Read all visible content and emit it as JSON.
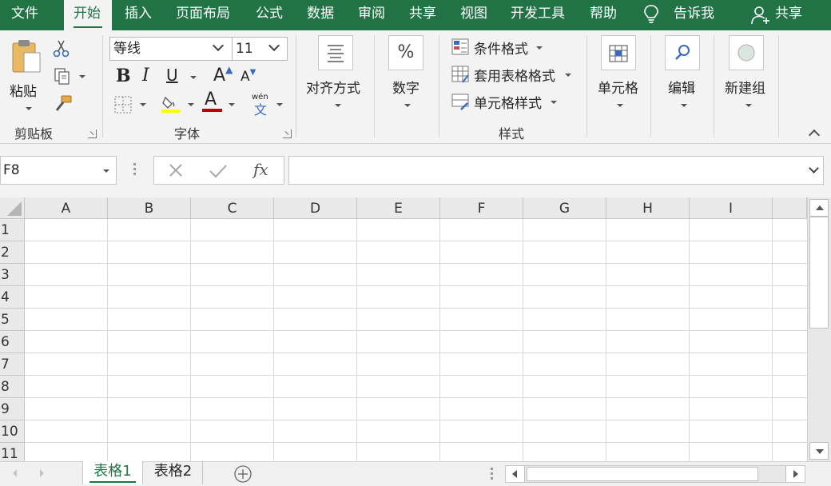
{
  "menu": {
    "tabs": [
      {
        "label": "文件"
      },
      {
        "label": "开始"
      },
      {
        "label": "插入"
      },
      {
        "label": "页面布局"
      },
      {
        "label": "公式"
      },
      {
        "label": "数据"
      },
      {
        "label": "审阅"
      },
      {
        "label": "共享"
      },
      {
        "label": "视图"
      },
      {
        "label": "开发工具"
      },
      {
        "label": "帮助"
      }
    ],
    "tell_me": "告诉我",
    "share": "共享"
  },
  "ribbon": {
    "clipboard": {
      "label": "剪贴板",
      "paste": "粘贴"
    },
    "font": {
      "label": "字体",
      "font_name": "等线",
      "font_size": "11",
      "phonetic_top": "wén",
      "phonetic_bottom": "文"
    },
    "alignment": {
      "label": "对齐方式"
    },
    "number": {
      "label": "数字",
      "symbol": "%"
    },
    "styles": {
      "label": "样式",
      "conditional": "条件格式",
      "table": "套用表格格式",
      "cell": "单元格样式"
    },
    "cells": {
      "label": "单元格"
    },
    "editing": {
      "label": "编辑"
    },
    "new_group": {
      "label": "新建组"
    }
  },
  "formula_bar": {
    "name_box": "F8",
    "formula": ""
  },
  "grid": {
    "columns": [
      "A",
      "B",
      "C",
      "D",
      "E",
      "F",
      "G",
      "H",
      "I"
    ],
    "rows": [
      "1",
      "2",
      "3",
      "4",
      "5",
      "6",
      "7",
      "8",
      "9",
      "10",
      "11"
    ]
  },
  "sheets": {
    "tabs": [
      "表格1",
      "表格2"
    ],
    "active": 0
  },
  "colors": {
    "accent": "#217346",
    "highlight_yellow": "#ffff00",
    "font_red": "#c00000"
  }
}
